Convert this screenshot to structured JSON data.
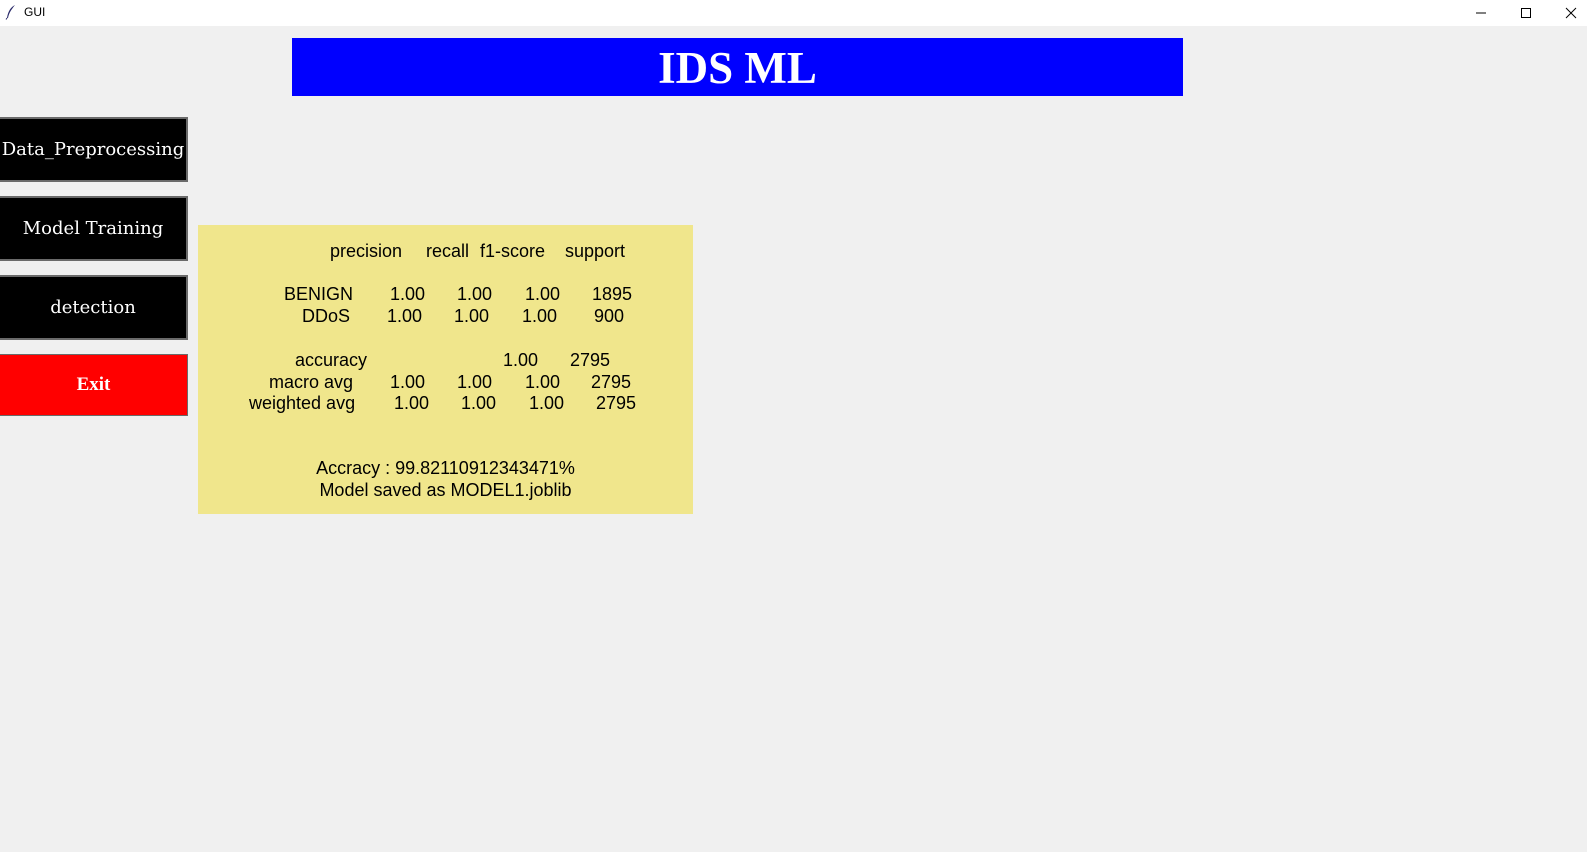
{
  "window": {
    "title": "GUI",
    "controls": {
      "minimize": "minimize-icon",
      "maximize": "maximize-icon",
      "close": "close-icon"
    }
  },
  "header": {
    "title": "IDS ML",
    "background": "#0000ff",
    "color": "#ffffff"
  },
  "sidebar": {
    "buttons": [
      {
        "label": "Data_Preprocessing",
        "bg": "#000000"
      },
      {
        "label": "Model Training",
        "bg": "#000000"
      },
      {
        "label": "detection",
        "bg": "#000000"
      },
      {
        "label": "Exit",
        "bg": "#ff0000"
      }
    ]
  },
  "report": {
    "background": "#f0e68c",
    "columns": [
      "precision",
      "recall",
      "f1-score",
      "support"
    ],
    "rows": [
      {
        "label": "BENIGN",
        "precision": "1.00",
        "recall": "1.00",
        "f1": "1.00",
        "support": "1895"
      },
      {
        "label": "DDoS",
        "precision": "1.00",
        "recall": "1.00",
        "f1": "1.00",
        "support": "900"
      }
    ],
    "accuracy": {
      "label": "accuracy",
      "f1": "1.00",
      "support": "2795"
    },
    "averages": [
      {
        "label": "macro avg",
        "precision": "1.00",
        "recall": "1.00",
        "f1": "1.00",
        "support": "2795"
      },
      {
        "label": "weighted avg",
        "precision": "1.00",
        "recall": "1.00",
        "f1": "1.00",
        "support": "2795"
      }
    ],
    "accuracy_line": "Accracy : 99.82110912343471%",
    "saved_line": "Model saved as MODEL1.joblib"
  }
}
